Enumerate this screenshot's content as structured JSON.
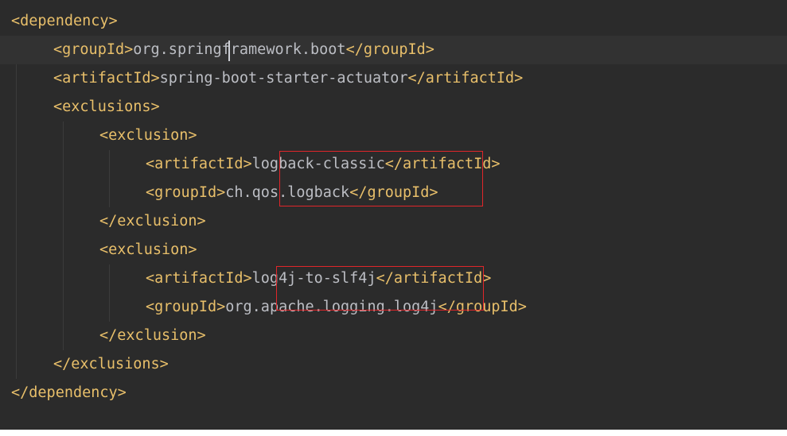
{
  "editor": {
    "background_color": "#2b2b2b",
    "tag_color": "#e8bf6a",
    "text_color": "#bcbec4",
    "highlight_color": "#e0262a",
    "lines": [
      {
        "indent": 0,
        "open": "<dependency>",
        "text": "",
        "close": ""
      },
      {
        "indent": 1,
        "open": "<groupId>",
        "text": "org.springframework.boot",
        "close": "</groupId>"
      },
      {
        "indent": 1,
        "open": "<artifactId>",
        "text": "spring-boot-starter-actuator",
        "close": "</artifactId>"
      },
      {
        "indent": 1,
        "open": "<exclusions>",
        "text": "",
        "close": ""
      },
      {
        "indent": 2,
        "open": "<exclusion>",
        "text": "",
        "close": ""
      },
      {
        "indent": 3,
        "open": "<artifactId>",
        "text": "logback-classic",
        "close": "</artifactId>"
      },
      {
        "indent": 3,
        "open": "<groupId>",
        "text": "ch.qos.logback",
        "close": "</groupId>"
      },
      {
        "indent": 2,
        "open": "</exclusion>",
        "text": "",
        "close": ""
      },
      {
        "indent": 2,
        "open": "<exclusion>",
        "text": "",
        "close": ""
      },
      {
        "indent": 3,
        "open": "<artifactId>",
        "text": "log4j-to-slf4j",
        "close": "</artifactId>"
      },
      {
        "indent": 3,
        "open": "<groupId>",
        "text": "org.apache.logging.log4j",
        "close": "</groupId>"
      },
      {
        "indent": 2,
        "open": "</exclusion>",
        "text": "",
        "close": ""
      },
      {
        "indent": 1,
        "open": "</exclusions>",
        "text": "",
        "close": ""
      },
      {
        "indent": 0,
        "open": "</dependency>",
        "text": "",
        "close": ""
      }
    ],
    "current_line": 2,
    "highlighted_lines": [
      6,
      10
    ]
  }
}
